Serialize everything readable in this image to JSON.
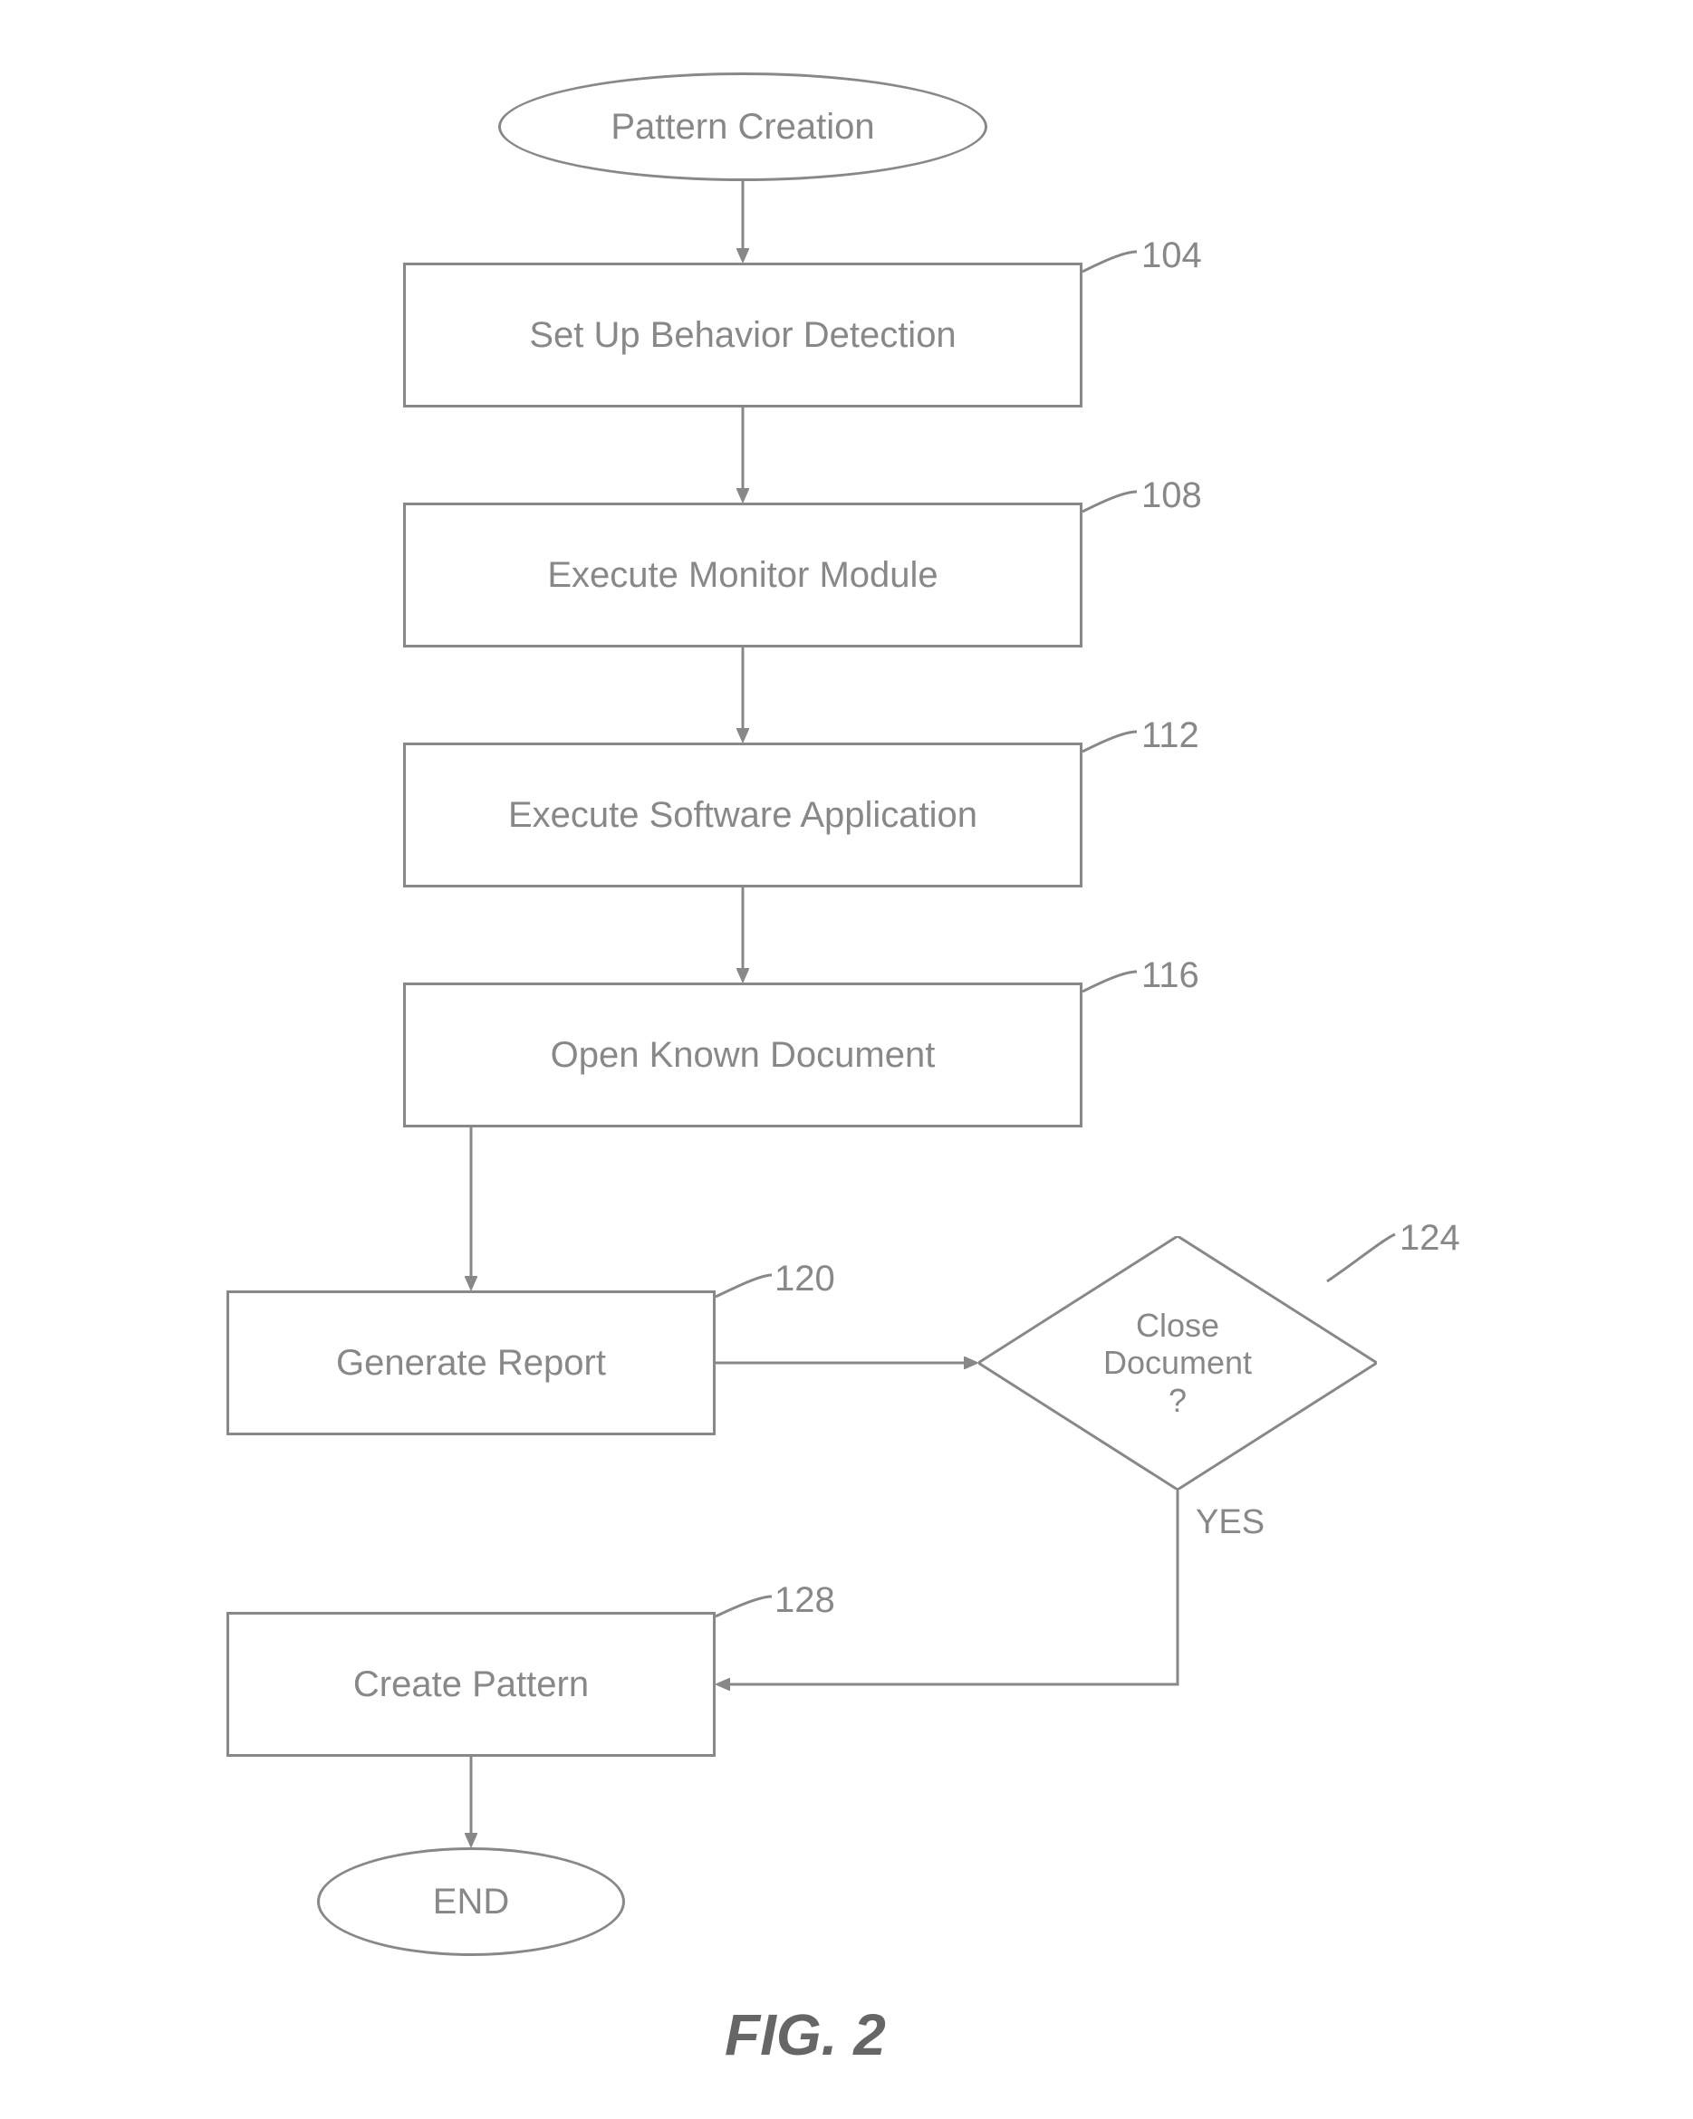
{
  "figure_caption": "FIG. 2",
  "nodes": {
    "start": {
      "label": "Pattern Creation",
      "ref": ""
    },
    "n104": {
      "label": "Set Up Behavior Detection",
      "ref": "104"
    },
    "n108": {
      "label": "Execute Monitor Module",
      "ref": "108"
    },
    "n112": {
      "label": "Execute Software Application",
      "ref": "112"
    },
    "n116": {
      "label": "Open Known Document",
      "ref": "116"
    },
    "n120": {
      "label": "Generate Report",
      "ref": "120"
    },
    "n124": {
      "label": "Close\nDocument\n?",
      "ref": "124"
    },
    "n128": {
      "label": "Create Pattern",
      "ref": "128"
    },
    "end": {
      "label": "END",
      "ref": ""
    }
  },
  "edges": {
    "n124_yes": {
      "label": "YES"
    }
  }
}
